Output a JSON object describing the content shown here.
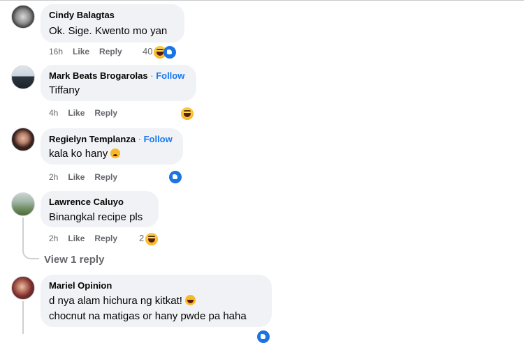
{
  "comments": [
    {
      "author": "Cindy Balagtas",
      "follow": "",
      "text": "Ok. Sige. Kwento mo yan",
      "time": "16h",
      "like": "Like",
      "reply": "Reply",
      "reaction_count": "40",
      "reactions": [
        "haha-icon",
        "like-icon"
      ]
    },
    {
      "author": "Mark Beats Brogarolas",
      "follow": "Follow",
      "text": "Tiffany",
      "time": "4h",
      "like": "Like",
      "reply": "Reply",
      "reaction_count": "",
      "reactions": [
        "haha-icon"
      ]
    },
    {
      "author": "Regielyn Templanza",
      "follow": "Follow",
      "text": "kala ko hany",
      "time": "2h",
      "like": "Like",
      "reply": "Reply",
      "reaction_count": "",
      "reactions": [
        "like-icon"
      ]
    },
    {
      "author": "Lawrence Caluyo",
      "follow": "",
      "text": "Binangkal recipe pls",
      "time": "2h",
      "like": "Like",
      "reply": "Reply",
      "reaction_count": "2",
      "reactions": [
        "haha-icon"
      ],
      "view_replies": "View 1 reply"
    },
    {
      "author": "Mariel Opinion",
      "follow": "",
      "text_line1": "d nya alam hichura ng kitkat!",
      "text_line2": "chocnut na matigas or hany pwde pa haha"
    }
  ],
  "separator": " · ",
  "colors": {
    "bubble": "#f0f2f5",
    "link": "#1877f2",
    "meta": "#65676b",
    "like_blue": "#1b74e4",
    "haha_yellow": "#f7b928"
  }
}
